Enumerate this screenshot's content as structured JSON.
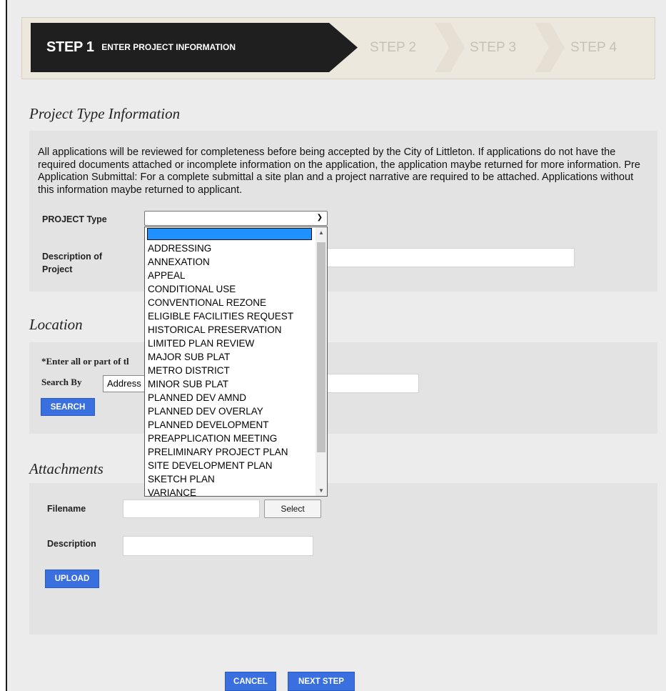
{
  "stepper": {
    "step1_num": "STEP 1",
    "step1_title": "ENTER PROJECT INFORMATION",
    "step2": "STEP 2",
    "step3": "STEP 3",
    "step4": "STEP 4"
  },
  "project_type_section": {
    "heading": "Project Type Information",
    "intro": "All applications will be reviewed for completeness before being accepted by the City of Littleton. If applications do not have the required documents attached or incomplete information on the application, the application maybe returned for more information. Pre Application Submittal: For a complete submittal a site plan and a project narrative are required to be attached. Applications without this information maybe returned to applicant.",
    "project_type_label": "PROJECT Type",
    "project_type_value": "",
    "description_label_line1": "Description of",
    "description_label_line2": "Project",
    "description_value": ""
  },
  "dropdown": {
    "options": [
      "ADDRESSING",
      "ANNEXATION",
      "APPEAL",
      "CONDITIONAL USE",
      "CONVENTIONAL REZONE",
      "ELIGIBLE FACILITIES REQUEST",
      "HISTORICAL PRESERVATION",
      "LIMITED PLAN REVIEW",
      "MAJOR SUB PLAT",
      "METRO DISTRICT",
      "MINOR SUB PLAT",
      "PLANNED DEV AMND",
      "PLANNED DEV OVERLAY",
      "PLANNED DEVELOPMENT",
      "PREAPPLICATION MEETING",
      "PRELIMINARY PROJECT PLAN",
      "SITE DEVELOPMENT PLAN",
      "SKETCH PLAN",
      "VARIANCE"
    ],
    "selected_index": 0
  },
  "location_section": {
    "heading": "Location",
    "instruction": "*Enter all or part of tl",
    "search_by_label": "Search By",
    "search_by_value": "Address",
    "search_value": "",
    "search_button": "SEARCH"
  },
  "attachments_section": {
    "heading": "Attachments",
    "filename_label": "Filename",
    "filename_value": "",
    "select_button": "Select",
    "description_label": "Description",
    "description_value": "",
    "upload_button": "UPLOAD"
  },
  "footer": {
    "cancel_button": "CANCEL",
    "next_button": "NEXT STEP"
  },
  "colors": {
    "accent_blue": "#3a6fe0",
    "active_step_bg": "#1f1f1f",
    "dropdown_highlight": "#1e90ff"
  }
}
